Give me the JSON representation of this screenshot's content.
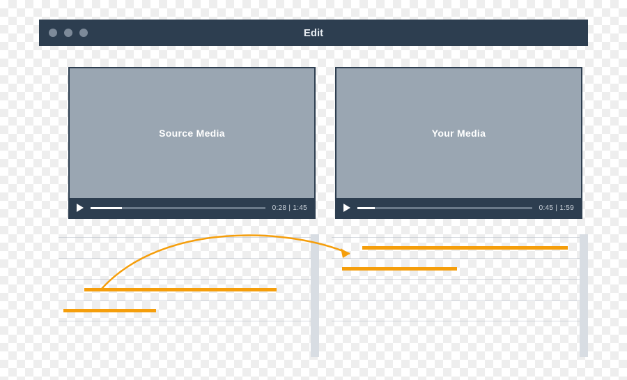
{
  "window": {
    "title": "Edit"
  },
  "players": {
    "source": {
      "label": "Source Media",
      "time_current": "0:28",
      "time_total": "1:45",
      "time_display": "0:28 | 1:45",
      "progress_pct": 18
    },
    "your": {
      "label": "Your Media",
      "time_current": "0:45",
      "time_total": "1:59",
      "time_display": "0:45 | 1:59",
      "progress_pct": 10
    }
  },
  "timeline": {
    "lane_count": 5,
    "left": {
      "clips": [
        {
          "lane": 2,
          "left_pct": 10,
          "width_pct": 75
        },
        {
          "lane": 3,
          "left_pct": 2,
          "width_pct": 36
        }
      ]
    },
    "right": {
      "clips": [
        {
          "lane": 0,
          "left_pct": 12,
          "width_pct": 80
        },
        {
          "lane": 1,
          "left_pct": 4,
          "width_pct": 45
        }
      ]
    }
  },
  "colors": {
    "chrome": "#2d3e50",
    "pane_fill": "#9aa6b2",
    "clip": "#f59e0b",
    "scroll": "#d8dde3"
  }
}
